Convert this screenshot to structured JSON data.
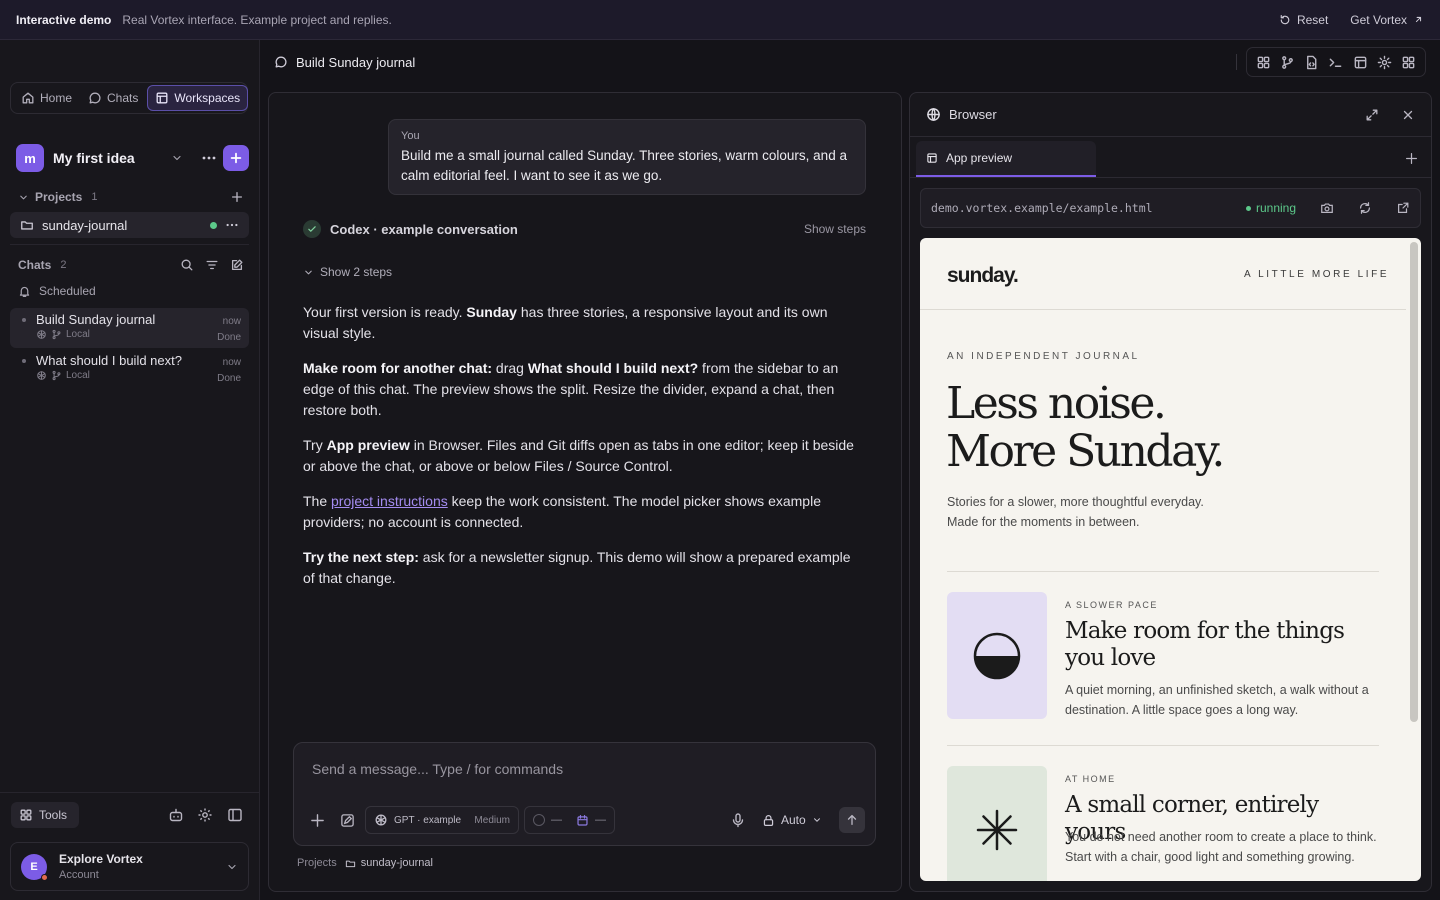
{
  "demo_bar": {
    "title": "Interactive demo",
    "subtitle": "Real Vortex interface. Example project and replies.",
    "reset_label": "Reset",
    "get_label": "Get Vortex"
  },
  "sidebar": {
    "tabs": [
      {
        "label": "Home",
        "icon": "home-icon"
      },
      {
        "label": "Chats",
        "icon": "chat-icon"
      },
      {
        "label": "Workspaces",
        "icon": "layout-icon",
        "active": true
      }
    ],
    "workspace": {
      "initial": "m",
      "name": "My first idea"
    },
    "projects": {
      "label": "Projects",
      "count": "1",
      "items": [
        {
          "name": "sunday-journal"
        }
      ]
    },
    "chats": {
      "label": "Chats",
      "count": "2",
      "scheduled": "Scheduled",
      "items": [
        {
          "title": "Build Sunday journal",
          "location": "Local",
          "time": "now",
          "status": "Done"
        },
        {
          "title": "What should I build next?",
          "location": "Local",
          "time": "now",
          "status": "Done"
        }
      ]
    },
    "tools_label": "Tools",
    "account": {
      "initial": "E",
      "name": "Explore Vortex",
      "sub": "Account"
    }
  },
  "header": {
    "title": "Build Sunday journal"
  },
  "chat": {
    "user_label": "You",
    "user_message": "Build me a small journal called Sunday. Three stories, warm colours, and a calm editorial feel. I want to see it as we go.",
    "agent_label": "Codex · example conversation",
    "show_steps_right": "Show steps",
    "show_steps_toggle": "Show 2 steps",
    "reply": {
      "p1_a": "Your first version is ready. ",
      "p1_b": "Sunday",
      "p1_c": " has three stories, a responsive layout and its own visual style.",
      "p2_a": "Make room for another chat:",
      "p2_b": " drag ",
      "p2_c": "What should I build next?",
      "p2_d": " from the sidebar to an edge of this chat. The preview shows the split. Resize the divider, expand a chat, then restore both.",
      "p3_a": "Try ",
      "p3_b": "App preview",
      "p3_c": " in Browser. Files and Git diffs open as tabs in one editor; keep it beside or above the chat, or above or below Files / Source Control.",
      "p4_a": "The ",
      "p4_link": "project instructions",
      "p4_b": " keep the work consistent. The model picker shows example providers; no account is connected.",
      "p5_a": "Try the next step:",
      "p5_b": " ask for a newsletter signup. This demo will show a prepared example of that change."
    },
    "composer": {
      "placeholder": "Send a message... Type / for commands",
      "model": "GPT · example",
      "effort": "Medium",
      "ctl1": "—",
      "ctl2": "—",
      "mode": "Auto"
    },
    "breadcrumb": {
      "root": "Projects",
      "current": "sunday-journal"
    }
  },
  "browser": {
    "title": "Browser",
    "tab": "App preview",
    "url": "demo.vortex.example/example.html",
    "status": "running",
    "site": {
      "logo": "sunday.",
      "tagline": "A LITTLE MORE LIFE",
      "kicker": "AN INDEPENDENT JOURNAL",
      "hero_line1": "Less noise.",
      "hero_line2": "More Sunday.",
      "lede_line1": "Stories for a slower, more thoughtful everyday.",
      "lede_line2": "Made for the moments in between.",
      "cards": [
        {
          "kicker": "A SLOWER PACE",
          "title": "Make room for the things you love",
          "desc": "A quiet morning, an unfinished sketch, a walk without a destination. A little space goes a long way.",
          "color": "#e3ddf3"
        },
        {
          "kicker": "AT HOME",
          "title": "A small corner, entirely yours",
          "desc": "You do not need another room to create a place to think. Start with a chair, good light and something growing.",
          "color": "#dfe7dc"
        }
      ]
    }
  },
  "colors": {
    "accent": "#7c5ce6",
    "running": "#5cc98a",
    "link": "#a48cf0"
  }
}
